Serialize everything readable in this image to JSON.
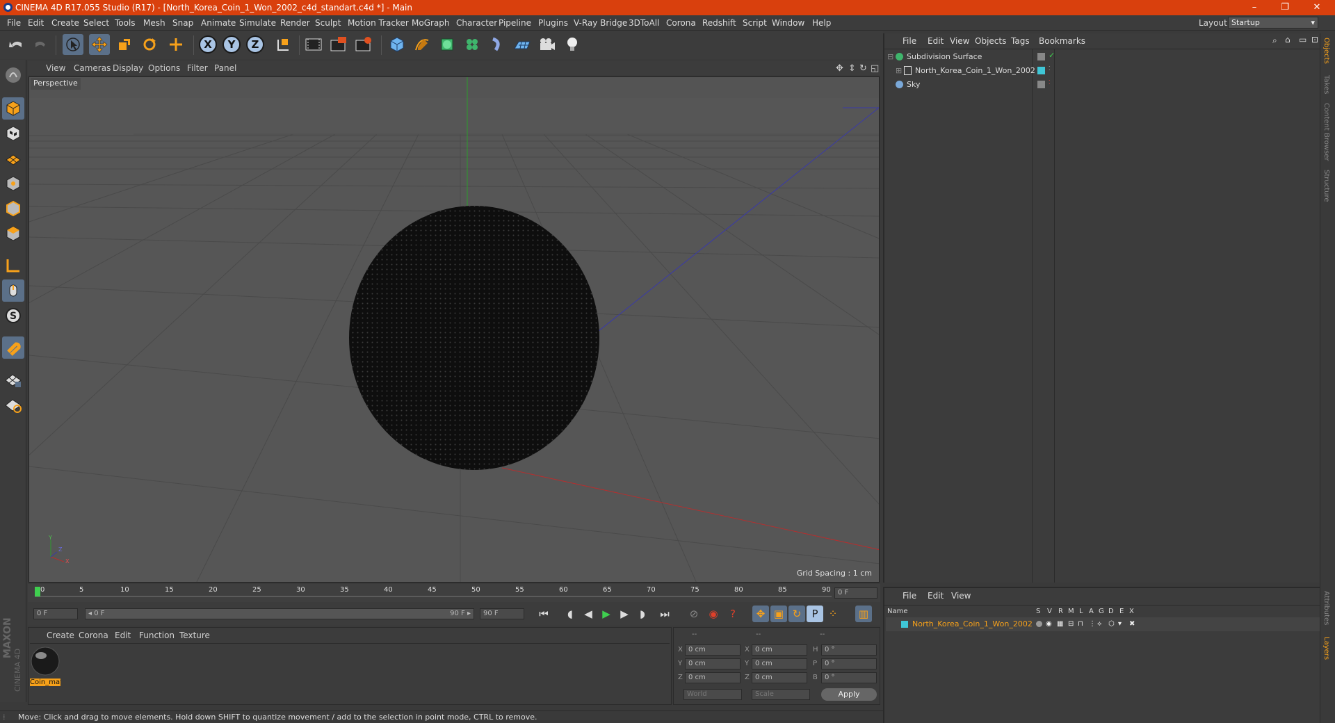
{
  "window": {
    "title": "CINEMA 4D R17.055 Studio (R17) - [North_Korea_Coin_1_Won_2002_c4d_standart.c4d *] - Main",
    "min": "–",
    "max": "❐",
    "close": "✕"
  },
  "menubar": {
    "items": [
      "File",
      "Edit",
      "Create",
      "Select",
      "Tools",
      "Mesh",
      "Snap",
      "Animate",
      "Simulate",
      "Render",
      "Sculpt",
      "Motion Tracker",
      "MoGraph",
      "Character",
      "Pipeline",
      "Plugins",
      "V-Ray Bridge",
      "3DToAll",
      "Corona",
      "Redshift",
      "Script",
      "Window",
      "Help"
    ],
    "layout_label": "Layout:",
    "layout_value": "Startup"
  },
  "toolbar": {
    "axis_x": "X",
    "axis_y": "Y",
    "axis_z": "Z"
  },
  "viewport": {
    "menu": [
      "View",
      "Cameras",
      "Display",
      "Options",
      "Filter",
      "Panel"
    ],
    "label": "Perspective",
    "grid_spacing": "Grid Spacing : 1 cm",
    "axis_y": "Y",
    "axis_z": "Z",
    "axis_x": "X"
  },
  "timeline": {
    "ticks": [
      "0",
      "5",
      "10",
      "15",
      "20",
      "25",
      "30",
      "35",
      "40",
      "45",
      "50",
      "55",
      "60",
      "65",
      "70",
      "75",
      "80",
      "85",
      "90"
    ],
    "frame_field": "0 F",
    "start_field": "0 F",
    "range_start": "◂ 0 F",
    "range_end": "90 F ▸",
    "end_field": "90 F"
  },
  "material_manager": {
    "menu": [
      "Create",
      "Corona",
      "Edit",
      "Function",
      "Texture"
    ],
    "material_name": "Coin_mat",
    "brand_top": "MAXON",
    "brand_bottom": "CINEMA 4D"
  },
  "coordinates": {
    "header": [
      "--",
      "--",
      "--"
    ],
    "rows": [
      {
        "a": "X",
        "av": "0 cm",
        "b": "X",
        "bv": "0 cm",
        "c": "H",
        "cv": "0 °"
      },
      {
        "a": "Y",
        "av": "0 cm",
        "b": "Y",
        "bv": "0 cm",
        "c": "P",
        "cv": "0 °"
      },
      {
        "a": "Z",
        "av": "0 cm",
        "b": "Z",
        "bv": "0 cm",
        "c": "B",
        "cv": "0 °"
      }
    ],
    "world": "World",
    "scale": "Scale",
    "apply": "Apply"
  },
  "status": {
    "text": "Move: Click and drag to move elements. Hold down SHIFT to quantize movement / add to the selection in point mode, CTRL to remove."
  },
  "object_manager": {
    "menu": [
      "File",
      "Edit",
      "View",
      "Objects",
      "Tags",
      "Bookmarks"
    ],
    "objects": [
      {
        "name": "Subdivision Surface"
      },
      {
        "name": "North_Korea_Coin_1_Won_2002"
      },
      {
        "name": "Sky"
      }
    ]
  },
  "layer_manager": {
    "menu": [
      "File",
      "Edit",
      "View"
    ],
    "columns": [
      "Name",
      "S",
      "V",
      "R",
      "M",
      "L",
      "A",
      "G",
      "D",
      "E",
      "X"
    ],
    "layer_name": "North_Korea_Coin_1_Won_2002"
  },
  "right_tabs": [
    "Objects",
    "Takes",
    "Content Browser",
    "Structure",
    "Attributes",
    "Layers"
  ],
  "colors": {
    "title": "#d9400d",
    "accent": "#f7a11a",
    "select": "#5b7089",
    "layer": "#3fc6d6"
  }
}
